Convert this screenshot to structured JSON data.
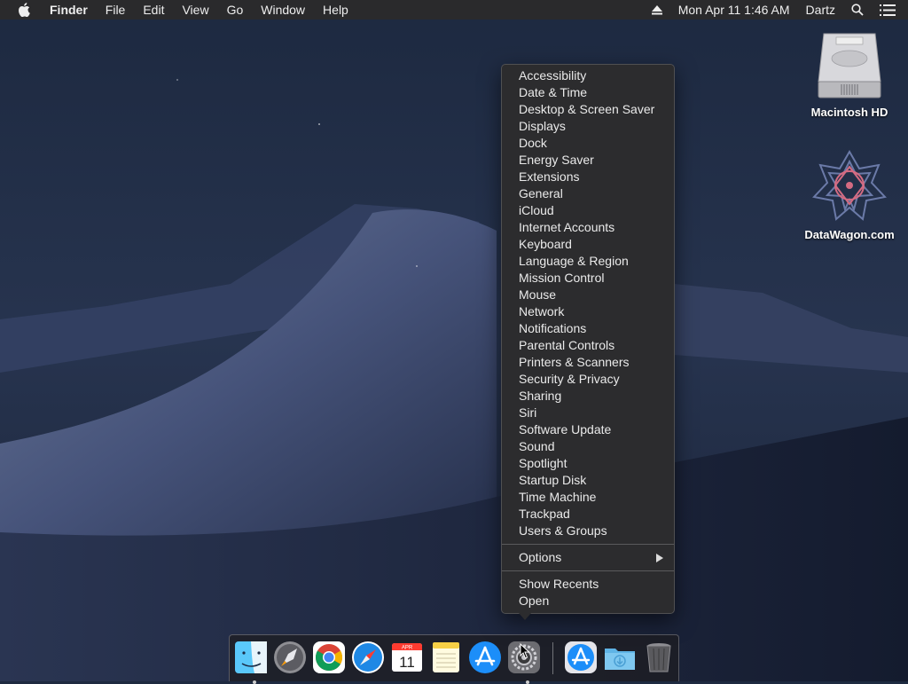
{
  "menubar": {
    "app_name": "Finder",
    "menus": [
      "File",
      "Edit",
      "View",
      "Go",
      "Window",
      "Help"
    ],
    "datetime": "Mon Apr 11  1:46 AM",
    "user": "Dartz",
    "icons": [
      "apple-icon",
      "eject-icon",
      "search-icon",
      "list-icon"
    ]
  },
  "desktop": {
    "icons": [
      {
        "label": "Macintosh HD",
        "icon": "hard-drive-icon"
      },
      {
        "label": "DataWagon.com",
        "icon": "star-pattern-icon"
      }
    ]
  },
  "context_menu": {
    "items": [
      "Accessibility",
      "Date & Time",
      "Desktop & Screen Saver",
      "Displays",
      "Dock",
      "Energy Saver",
      "Extensions",
      "General",
      "iCloud",
      "Internet Accounts",
      "Keyboard",
      "Language & Region",
      "Mission Control",
      "Mouse",
      "Network",
      "Notifications",
      "Parental Controls",
      "Printers & Scanners",
      "Security & Privacy",
      "Sharing",
      "Siri",
      "Software Update",
      "Sound",
      "Spotlight",
      "Startup Disk",
      "Time Machine",
      "Trackpad",
      "Users & Groups"
    ],
    "options_label": "Options",
    "show_recents_label": "Show Recents",
    "open_label": "Open"
  },
  "calendar_icon": {
    "month": "APR",
    "day": "11"
  },
  "dock": {
    "apps": [
      "finder-icon",
      "launchpad-icon",
      "chrome-icon",
      "safari-icon",
      "calendar-icon",
      "notes-icon",
      "app-store-icon",
      "system-preferences-icon",
      "app-store-download-icon",
      "downloads-folder-icon",
      "trash-icon"
    ]
  },
  "colors": {
    "menu_bg": "#2c2c2e",
    "menubar_bg": "#2a2a2c",
    "wallpaper_sky": "#1e2a40"
  }
}
